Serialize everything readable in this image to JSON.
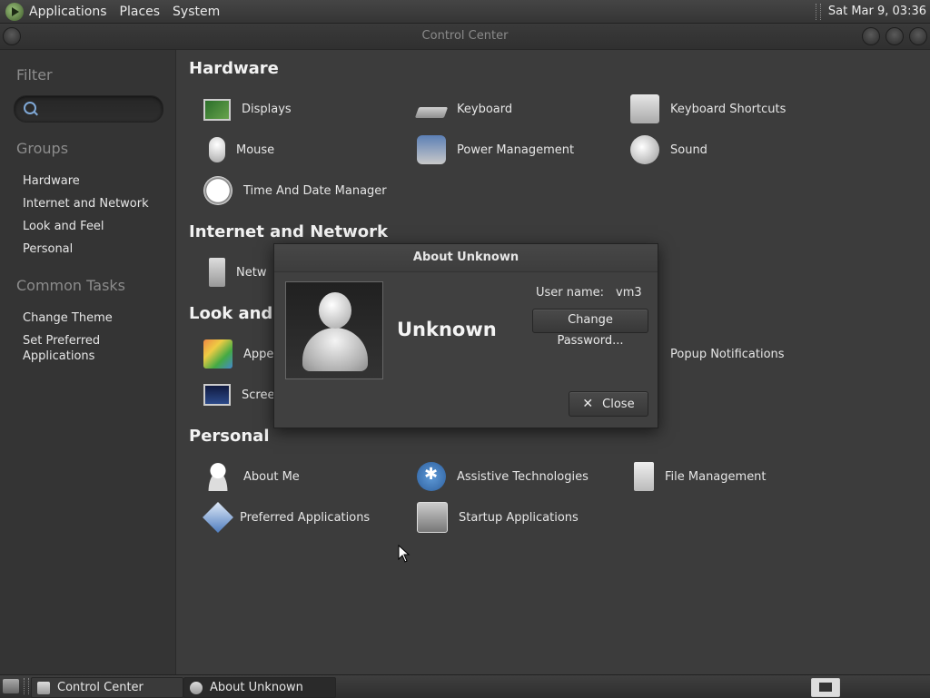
{
  "top_panel": {
    "menus": [
      "Applications",
      "Places",
      "System"
    ],
    "clock": "Sat Mar  9, 03:36"
  },
  "window": {
    "title": "Control Center"
  },
  "sidebar": {
    "filter_heading": "Filter",
    "search_placeholder": "",
    "groups_heading": "Groups",
    "groups": [
      "Hardware",
      "Internet and Network",
      "Look and Feel",
      "Personal"
    ],
    "tasks_heading": "Common Tasks",
    "tasks": [
      "Change Theme",
      "Set Preferred Applications"
    ]
  },
  "main": {
    "hardware": {
      "title": "Hardware",
      "items": [
        "Displays",
        "Keyboard",
        "Keyboard Shortcuts",
        "Mouse",
        "Power Management",
        "Sound",
        "Time And Date Manager"
      ]
    },
    "internet": {
      "title": "Internet and Network",
      "items": [
        "Netw"
      ]
    },
    "look": {
      "title": "Look and F",
      "items": [
        "Appe",
        "Popup Notifications",
        "Scree"
      ]
    },
    "personal": {
      "title": "Personal",
      "items": [
        "About Me",
        "Assistive Technologies",
        "File Management",
        "Preferred Applications",
        "Startup Applications"
      ]
    }
  },
  "dialog": {
    "title": "About Unknown",
    "full_name": "Unknown",
    "username_label": "User name:",
    "username_value": "vm3",
    "change_password_label": "Change Password...",
    "close_label": "Close"
  },
  "bottom_panel": {
    "tasks": [
      "Control Center",
      "About Unknown"
    ]
  },
  "icons": {
    "menu": "distro-logo-icon",
    "search": "search-icon",
    "close": "close-icon"
  }
}
